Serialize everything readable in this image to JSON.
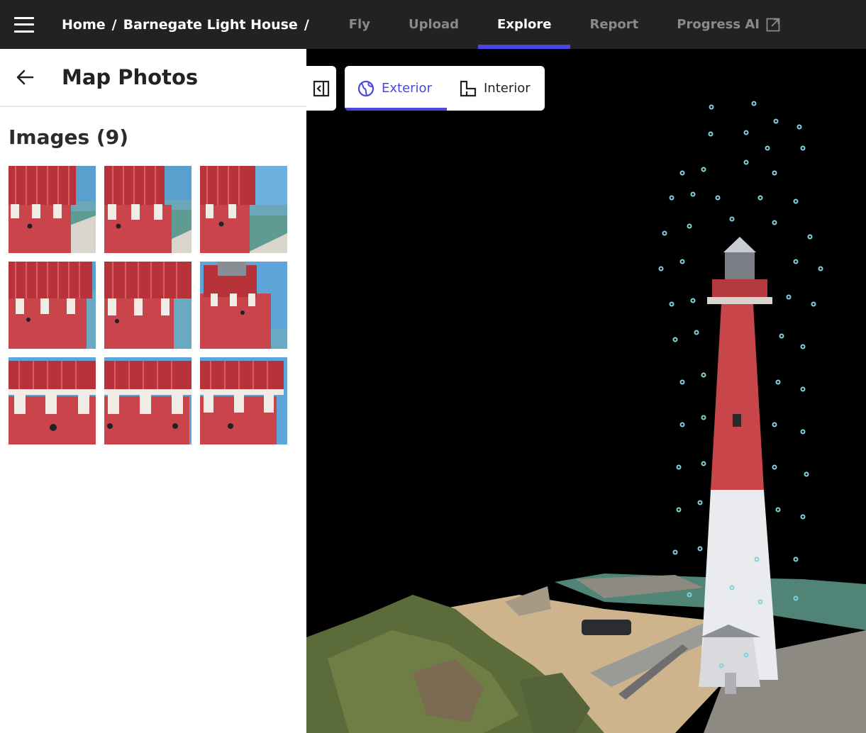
{
  "nav": {
    "breadcrumb": [
      {
        "label": "Home"
      },
      {
        "label": "Barnegate Light House"
      }
    ],
    "separator": "/",
    "tabs": [
      {
        "label": "Fly",
        "active": false
      },
      {
        "label": "Upload",
        "active": false
      },
      {
        "label": "Explore",
        "active": true
      },
      {
        "label": "Report",
        "active": false
      },
      {
        "label": "Progress AI",
        "active": false,
        "external": true
      }
    ],
    "accent_color": "#4a47e0"
  },
  "panel": {
    "title": "Map Photos",
    "images_heading": "Images (9)",
    "image_count": 9
  },
  "viewer": {
    "view_modes": [
      {
        "label": "Exterior",
        "icon": "globe-icon",
        "active": true
      },
      {
        "label": "Interior",
        "icon": "floorplan-icon",
        "active": false
      }
    ]
  }
}
